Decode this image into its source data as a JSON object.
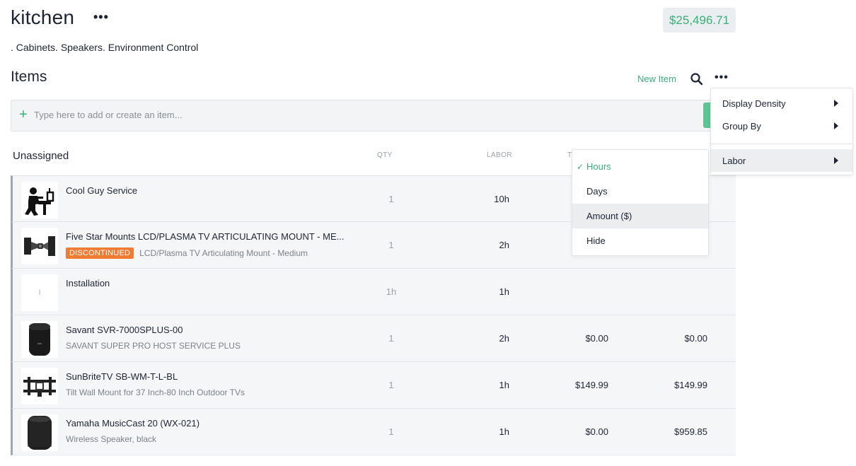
{
  "header": {
    "title": "kitchen",
    "more_glyph": "•••",
    "total": "$25,496.71",
    "subtitle": ". Cabinets. Speakers. Environment Control"
  },
  "items": {
    "title": "Items",
    "new_item_label": "New Item",
    "search_icon": "search-icon",
    "more_glyph": "•••"
  },
  "add_bar": {
    "plus_glyph": "+",
    "placeholder": "Type here to add or create an item..."
  },
  "group": {
    "title": "Unassigned",
    "columns": {
      "qty": "QTY",
      "labor": "LABOR",
      "third": "T"
    }
  },
  "rows": [
    {
      "name": "Cool Guy Service",
      "badge": "",
      "description": "",
      "qty": "1",
      "labor": "10h",
      "price": "",
      "total": "",
      "image": "technician-icon"
    },
    {
      "name": "Five Star Mounts LCD/PLASMA TV ARTICULATING MOUNT - ME...",
      "badge": "DISCONTINUED",
      "description": "LCD/Plasma TV Articulating Mount - Medium",
      "qty": "1",
      "labor": "2h",
      "price": "",
      "total": "",
      "image": "articulating-mount-image"
    },
    {
      "name": "Installation",
      "badge": "",
      "description": "",
      "qty": "1h",
      "labor": "1h",
      "price": "",
      "total": "",
      "image": "placeholder-letter",
      "letter": "I"
    },
    {
      "name": "Savant SVR-7000SPLUS-00",
      "badge": "",
      "description": "SAVANT SUPER PRO HOST SERVICE PLUS",
      "qty": "1",
      "labor": "2h",
      "price": "$0.00",
      "total": "$0.00",
      "image": "savant-host-image"
    },
    {
      "name": "SunBriteTV SB-WM-T-L-BL",
      "badge": "",
      "description": "Tilt Wall Mount for 37 Inch-80 Inch Outdoor TVs",
      "qty": "1",
      "labor": "1h",
      "price": "$149.99",
      "total": "$149.99",
      "image": "wall-mount-image"
    },
    {
      "name": "Yamaha MusicCast 20 (WX-021)",
      "badge": "",
      "description": "Wireless Speaker, black",
      "qty": "1",
      "labor": "1h",
      "price": "$0.00",
      "total": "$959.85",
      "image": "speaker-image"
    }
  ],
  "labor_submenu": {
    "items": [
      {
        "label": "Hours",
        "checked": true
      },
      {
        "label": "Days",
        "checked": false
      },
      {
        "label": "Amount ($)",
        "checked": false
      },
      {
        "label": "Hide",
        "checked": false
      }
    ],
    "check_glyph": "✓"
  },
  "options_menu": {
    "items": [
      {
        "label": "Display Density"
      },
      {
        "label": "Group By"
      },
      {
        "label": "Labor"
      }
    ]
  },
  "colors": {
    "accent": "#3aae7a",
    "badge": "#f07c34",
    "text": "#1c2434",
    "muted": "#9aa1a8"
  }
}
